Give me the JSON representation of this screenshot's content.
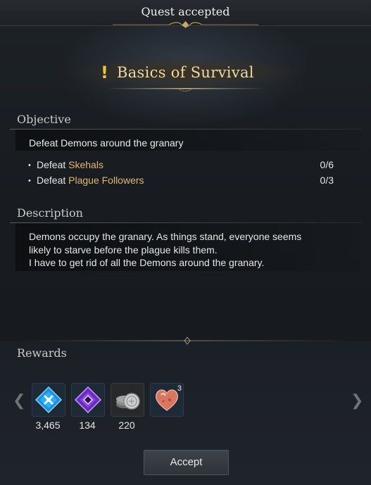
{
  "header": {
    "title": "Quest accepted"
  },
  "quest": {
    "icon": "exclamation-icon",
    "title": "Basics of Survival"
  },
  "objective": {
    "heading": "Objective",
    "summary": "Defeat Demons around the granary",
    "items": [
      {
        "verb": "Defeat",
        "target": "Skehals",
        "progress": "0/6"
      },
      {
        "verb": "Defeat",
        "target": "Plague Followers",
        "progress": "0/3"
      }
    ]
  },
  "description": {
    "heading": "Description",
    "lines": [
      "Demons occupy the granary. As things stand, everyone seems",
      "likely to starve before the plague kills them.",
      "I have to get rid of all the Demons around the granary."
    ]
  },
  "rewards": {
    "heading": "Rewards",
    "items": [
      {
        "icon": "blue-crest-icon",
        "quantity": "3,465",
        "stack": ""
      },
      {
        "icon": "purple-crest-icon",
        "quantity": "134",
        "stack": ""
      },
      {
        "icon": "silver-coins-icon",
        "quantity": "220",
        "stack": ""
      },
      {
        "icon": "heart-gem-icon",
        "quantity": "",
        "stack": "3"
      }
    ]
  },
  "buttons": {
    "accept": "Accept"
  },
  "colors": {
    "highlight": "#e2b86c",
    "quest_title": "#eed9a3",
    "exclamation": "#f2c33a"
  }
}
